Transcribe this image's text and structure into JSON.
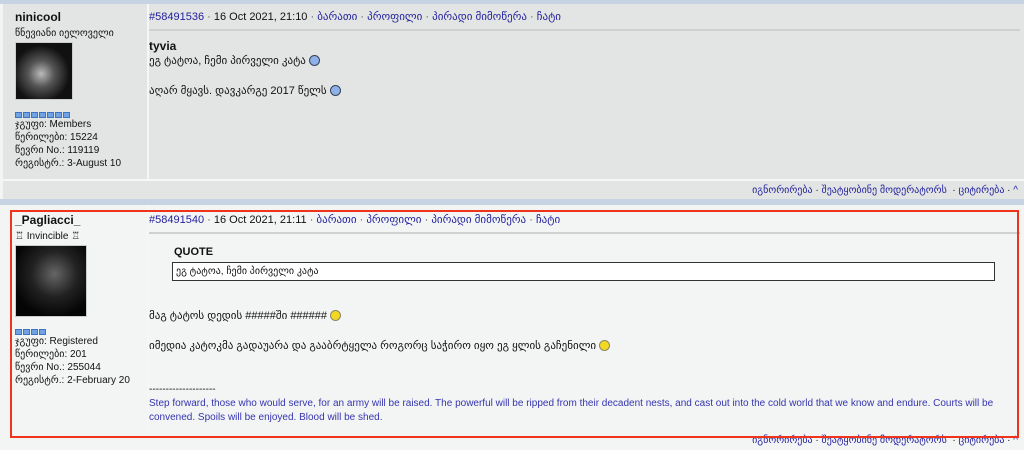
{
  "posts": [
    {
      "username": "ninicool",
      "title": "წნევიანი იელოველი",
      "group": "ჯგუფი: Members",
      "posts_count": "წერილები: 15224",
      "member_no": "წევრი No.: 119119",
      "registered": "რეგისტრ.: 3-August 10",
      "post_id": "#58491536",
      "date": "16 Oct 2021, 21:10",
      "subject": "tyvia",
      "lines": [
        "ეგ ტატოა, ჩემი პირველი კატა",
        "აღარ მყავს. დავკარგე 2017 წელს"
      ]
    },
    {
      "username": "_Pagliacci_",
      "title": "♖ Invincible ♖",
      "group": "ჯგუფი: Registered",
      "posts_count": "წერილები: 201",
      "member_no": "წევრი No.: 255044",
      "registered": "რეგისტრ.: 2-February 20",
      "post_id": "#58491540",
      "date": "16 Oct 2021, 21:11",
      "quote_label": "QUOTE",
      "quote_text": "ეგ ტატოა, ჩემი პირველი კატა",
      "lines": [
        "მაგ ტატოს დედის #####ში ######",
        "იმედია კატოკმა გადაუარა და გააბრტყელა როგორც საჭირო იყო ეგ ყლის გაჩენილი"
      ],
      "sig_divider": "--------------------",
      "signature": "Step forward, those who would serve, for an army will be raised. The powerful will be ripped from their decadent nests, and cast out into the cold world that we know and endure. Courts will be convened. Spoils will be enjoyed. Blood will be shed."
    }
  ],
  "links": {
    "card": "ბარათი",
    "profile": "პროფილი",
    "pm": "პირადი მიმოწერა",
    "chat": "ჩატი",
    "ignore": "იგნორირება",
    "report": "შეატყობინე მოდერატორს",
    "quote": "ციტირება",
    "top": "^"
  },
  "colors": {
    "link": "#1f1f9c",
    "highlight": "#f0341c",
    "pip": "#6fa3e4"
  }
}
